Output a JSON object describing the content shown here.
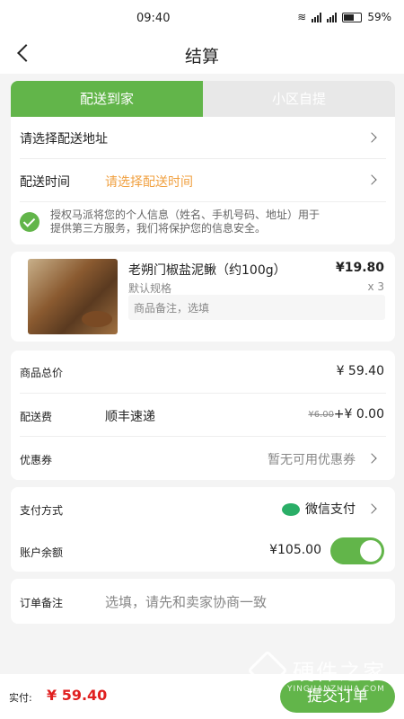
{
  "status": {
    "time": "09:40",
    "battery": "59%"
  },
  "header": {
    "title": "结算"
  },
  "tabs": [
    {
      "label": "配送到家",
      "active": true
    },
    {
      "label": "小区自提",
      "active": false
    }
  ],
  "address": {
    "select_label": "请选择配送地址",
    "time_label": "配送时间",
    "time_value": "请选择配送时间",
    "consent_text_line1": "授权马派将您的个人信息（姓名、手机号码、地址）用于",
    "consent_text_line2": "提供第三方服务，我们将保护您的信息安全。"
  },
  "product": {
    "name": "老朔门椒盐泥鳅（约100g）",
    "price": "¥19.80",
    "spec": "默认规格",
    "qty": "x 3",
    "note_placeholder": "商品备注，选填"
  },
  "summary": {
    "total_label": "商品总价",
    "total_value": "¥ 59.40",
    "delivery_label": "配送费",
    "delivery_method": "顺丰速递",
    "delivery_original": "¥6.00",
    "delivery_value": "+¥ 0.00",
    "coupon_label": "优惠券",
    "coupon_value": "暂无可用优惠券"
  },
  "payment": {
    "method_label": "支付方式",
    "method_value": "微信支付",
    "balance_label": "账户余额",
    "balance_value": "¥105.00",
    "balance_enabled": true
  },
  "remark": {
    "label": "订单备注",
    "placeholder": "选填，请先和卖家协商一致"
  },
  "footer": {
    "pay_label": "实付:",
    "pay_amount": "¥ 59.40",
    "submit_label": "提交订单"
  },
  "watermark": {
    "text": "硬件之家",
    "sub": "YINGJIANZHIJIA.COM"
  },
  "colors": {
    "accent": "#62b54a",
    "price_red": "#e02020",
    "orange": "#f0a040"
  }
}
